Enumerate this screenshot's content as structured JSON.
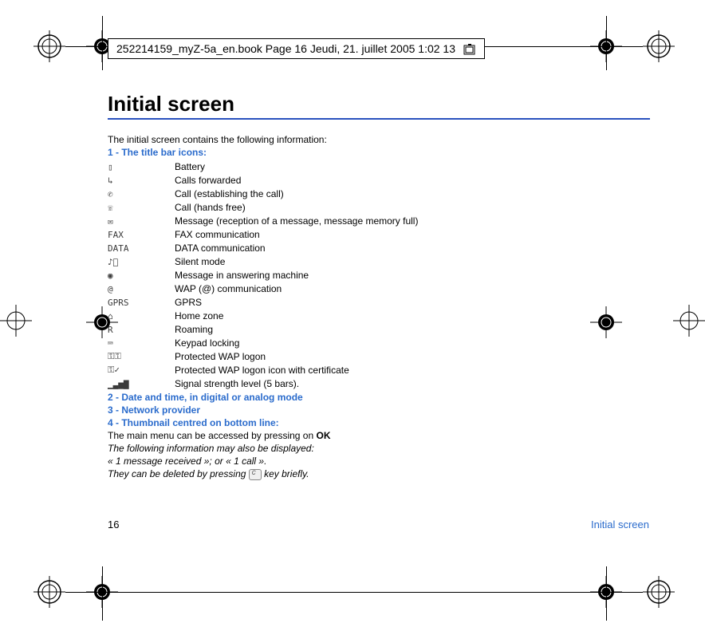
{
  "header": {
    "banner": "252214159_myZ-5a_en.book  Page 16  Jeudi, 21. juillet 2005  1:02 13"
  },
  "title": "Initial screen",
  "intro": "The initial screen contains the following information:",
  "section1_heading": "1 - The title bar icons:",
  "icons": [
    {
      "glyph": "▯",
      "label": "Battery"
    },
    {
      "glyph": "↳",
      "label": "Calls forwarded"
    },
    {
      "glyph": "✆",
      "label": "Call (establishing the call)"
    },
    {
      "glyph": "☏",
      "label": "Call (hands free)"
    },
    {
      "glyph": "✉",
      "label": "Message (reception of a message, message memory full)"
    },
    {
      "glyph": "FAX",
      "label": "FAX communication"
    },
    {
      "glyph": "DATA",
      "label": "DATA communication"
    },
    {
      "glyph": "♪⃠",
      "label": "Silent mode"
    },
    {
      "glyph": "◉",
      "label": "Message in answering machine"
    },
    {
      "glyph": "@",
      "label": "WAP (@) communication"
    },
    {
      "glyph": "GPRS",
      "label": "GPRS"
    },
    {
      "glyph": "⌂",
      "label": "Home zone"
    },
    {
      "glyph": "R",
      "label": "Roaming"
    },
    {
      "glyph": "⌨",
      "label": "Keypad locking"
    },
    {
      "glyph": "⚿⚿",
      "label": "Protected WAP logon"
    },
    {
      "glyph": "⚿✓",
      "label": "Protected WAP logon icon with certificate"
    },
    {
      "glyph": "▁▃▅▇",
      "label": "Signal strength level (5 bars)."
    }
  ],
  "section2_heading": "2 - Date and time, in digital or analog mode",
  "section3_heading": "3 - Network provider",
  "section4_heading": "4 - Thumbnail centred on bottom line:",
  "main_menu_pre": "The main menu can be accessed by pressing on ",
  "main_menu_bold": "OK",
  "italic1": "The following information may also be displayed:",
  "italic2": "« 1 message received »; or « 1 call ».",
  "italic3_pre": "They can be deleted by pressing ",
  "italic3_post": " key briefly.",
  "footer": {
    "page": "16",
    "section": "Initial screen"
  }
}
